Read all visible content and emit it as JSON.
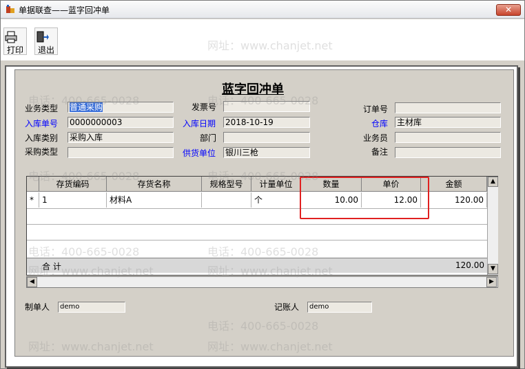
{
  "window": {
    "title": "单据联查——蓝字回冲单",
    "close_label": "✕"
  },
  "toolbar": {
    "print_label": "打印",
    "exit_label": "退出"
  },
  "doc": {
    "title": "蓝字回冲单",
    "fields": {
      "business_type": {
        "label": "业务类型",
        "value": "普通采购"
      },
      "invoice_no": {
        "label": "发票号",
        "value": ""
      },
      "order_no": {
        "label": "订单号",
        "value": ""
      },
      "receipt_no": {
        "label": "入库单号",
        "value": "0000000003"
      },
      "receipt_date": {
        "label": "入库日期",
        "value": "2018-10-19"
      },
      "warehouse": {
        "label": "仓库",
        "value": "主材库"
      },
      "receipt_type": {
        "label": "入库类别",
        "value": "采购入库"
      },
      "department": {
        "label": "部门",
        "value": ""
      },
      "salesperson": {
        "label": "业务员",
        "value": ""
      },
      "purchase_type": {
        "label": "采购类型",
        "value": ""
      },
      "supplier": {
        "label": "供货单位",
        "value": "银川三枪"
      },
      "remark": {
        "label": "备注",
        "value": ""
      }
    },
    "grid": {
      "columns": [
        "存货编码",
        "存货名称",
        "规格型号",
        "计量单位",
        "数量",
        "单价",
        "金额"
      ],
      "rows": [
        {
          "marker": "*",
          "code": "1",
          "name": "材料A",
          "spec": "",
          "unit": "个",
          "qty": "10.00",
          "price": "12.00",
          "amount": "120.00"
        }
      ],
      "total_label": "合 计",
      "total_amount": "120.00"
    },
    "footer": {
      "maker_label": "制单人",
      "maker_value": "demo",
      "bookkeeper_label": "记账人",
      "bookkeeper_value": "demo"
    }
  },
  "watermarks": {
    "phone": "电话：400-665-0028",
    "site": "网址：www.chanjet.net"
  },
  "colors": {
    "highlight": "#e02020",
    "blue_label": "#0000ff",
    "selection": "#3a6fd8"
  }
}
